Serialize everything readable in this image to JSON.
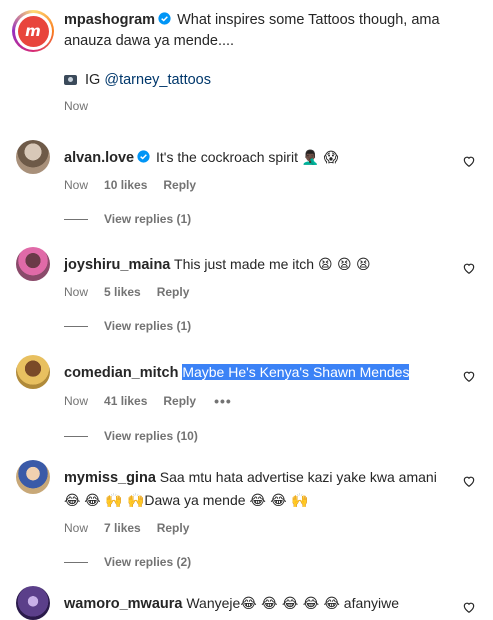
{
  "caption": {
    "username": "mpashogram",
    "text": "What inspires some Tattoos though, ama anauza dawa ya mende....",
    "ig_prefix": "IG",
    "mention": "@tarney_tattoos",
    "time": "Now",
    "avatar_letter": "m"
  },
  "comments": [
    {
      "username": "alvan.love",
      "verified": true,
      "text": "It's the cockroach spirit",
      "emoji": "🤦🏿‍♂️ 😱",
      "time": "Now",
      "likes": "10 likes",
      "reply": "Reply",
      "view_replies": "View replies (1)",
      "avatar_color": "#b39a85"
    },
    {
      "username": "joyshiru_maina",
      "text": "This just made me itch",
      "emoji": "😫 😫 😫",
      "time": "Now",
      "likes": "5 likes",
      "reply": "Reply",
      "view_replies": "View replies (1)",
      "avatar_color": "#b46a8a"
    },
    {
      "username": "comedian_mitch",
      "text": "Maybe He's Kenya's Shawn Mendes",
      "time": "Now",
      "likes": "41 likes",
      "reply": "Reply",
      "more": "•••",
      "view_replies": "View replies (10)",
      "avatar_color": "#c59a3d"
    },
    {
      "username": "mymiss_gina",
      "text": "Saa mtu hata advertise kazi yake kwa amani",
      "emoji1": "😂",
      "line2_emoji": "😂 🙌 🙌",
      "line2_text": "Dawa ya mende",
      "line2_emoji_end": "😂 😂 🙌",
      "time": "Now",
      "likes": "7 likes",
      "reply": "Reply",
      "view_replies": "View replies (2)",
      "avatar_color": "#6c88b8"
    },
    {
      "username": "wamoro_mwaura",
      "text": "Wanyeje",
      "emoji": "😂 😂 😂 😂 😂",
      "text2": "afanyiwe fumigation",
      "avatar_color": "#5b3f8a"
    }
  ]
}
